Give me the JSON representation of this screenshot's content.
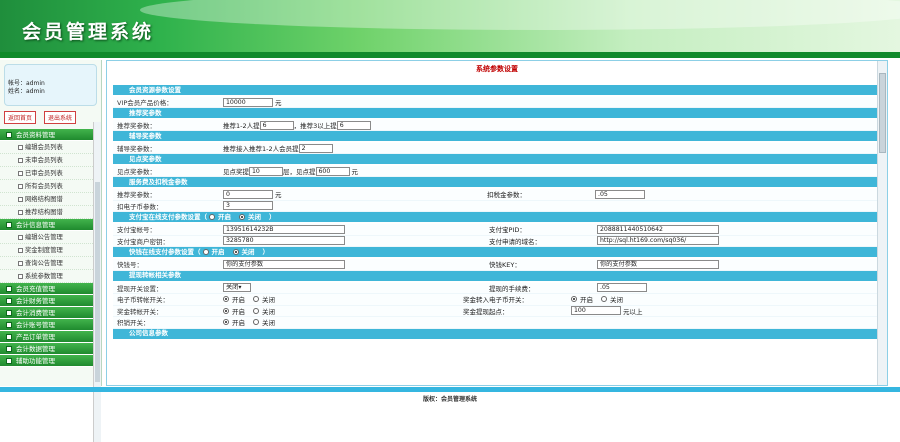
{
  "header": {
    "title": "会员管理系统"
  },
  "user": {
    "name_line": "帐号：admin",
    "role_line": "姓名：admin"
  },
  "top_buttons": [
    "返回首页",
    "退出系统"
  ],
  "sidebar": {
    "groups": [
      {
        "label": "会员资料管理",
        "items": [
          "编辑会员列表",
          "未审会员列表",
          "已审会员列表",
          "所有会员列表",
          "网络结构图谱",
          "推荐结构图谱"
        ]
      },
      {
        "label": "会计信息管理",
        "items": [
          "编辑公告管理",
          "奖金制度管理",
          "查询公告管理",
          "系统参数管理"
        ]
      },
      {
        "label": "会员充值管理",
        "items": []
      },
      {
        "label": "会计财务管理",
        "items": []
      },
      {
        "label": "会计消费管理",
        "items": []
      },
      {
        "label": "会计账号管理",
        "items": []
      },
      {
        "label": "产品订单管理",
        "items": []
      },
      {
        "label": "会计数据管理",
        "items": []
      },
      {
        "label": "辅助功能管理",
        "items": []
      }
    ]
  },
  "main": {
    "title": "系统参数设置",
    "sections": {
      "s1": "会员资源参数设置",
      "s2": "推荐奖参数",
      "s3": "辅导奖参数",
      "s4": "见点奖参数",
      "s5": "服务费及扣税金参数",
      "s6": "支付宝在线支付参数设置（",
      "s6b": "）",
      "s7": "快钱在线支付参数设置（",
      "s7b": "）",
      "s8": "提现转帐相关参数",
      "s9": "公司信息参数"
    },
    "labels": {
      "vip_price": "VIP会员产品价格：",
      "unit_yuan": "元",
      "recommend": "推荐奖参数：",
      "rec_a": "推荐1-2人提",
      "rec_b": "，推荐3以上提",
      "coach": "辅导奖参数：",
      "coach_a": "推荐接入推荐1-2人会员提",
      "view": "见点奖参数：",
      "view_a": "见点奖提",
      "view_b": "层，见点提",
      "view_c": "元",
      "service": "推荐奖参数：",
      "service_u": "元",
      "tax": "扣税金参数：",
      "deduct": "扣电子币参数：",
      "open": "开启",
      "close": "关闭",
      "alipay_acct": "支付宝帐号：",
      "alipay_pid": "支付宝PID：",
      "alipay_key": "支付宝商户密钥：",
      "alipay_url": "支付申请的域名：",
      "kq_acct": "快钱号：",
      "kq_key": "快钱KEY：",
      "withdraw": "提现开关设置：",
      "withdraw_fee": "提现的手续费：",
      "e_switch": "电子币转帐开关：",
      "bonus_to_e": "奖金转入电子币开关：",
      "bonus_switch": "奖金转帐开关：",
      "bonus_min": "奖金提现起点：",
      "bonus_min_u": "元以上",
      "gold_switch": "积销开关："
    },
    "values": {
      "vip_price": "10000",
      "rec_a": "6",
      "rec_b": "6",
      "coach_a": "2",
      "view_a": "10",
      "view_b": "600",
      "service": "0",
      "tax": ".05",
      "deduct": "3",
      "alipay_acct": "13951614232B",
      "alipay_pid": "2088811440510642",
      "alipay_key": "3285780",
      "alipay_url": "http://sql.ht169.com/sq036/",
      "kq_acct": "你的支付参数",
      "kq_key": "你的支付参数",
      "withdraw": "关闭",
      "withdraw_fee": ".05",
      "bonus_min": "100"
    }
  },
  "footer": {
    "text": "版权：会员管理系统"
  }
}
